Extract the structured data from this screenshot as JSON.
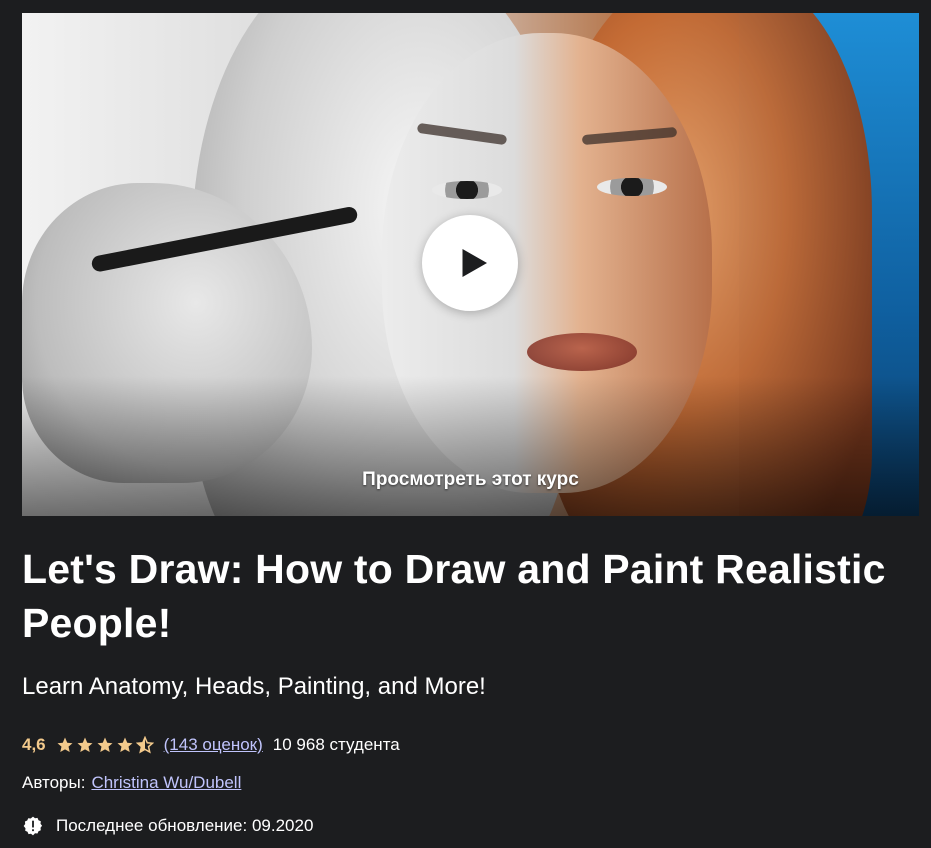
{
  "preview": {
    "caption": "Просмотреть этот курс",
    "play_icon": "play-icon"
  },
  "course": {
    "title": "Let's Draw: How to Draw and Paint Realistic People!",
    "subtitle": "Learn Anatomy, Heads, Painting, and More!",
    "rating": {
      "value": "4,6",
      "stars": 4.6,
      "reviews_text": "(143 оценок)",
      "students_text": "10 968 студента"
    },
    "authors_label": "Авторы:",
    "author_name": "Christina Wu/Dubell",
    "last_updated": "Последнее обновление: 09.2020",
    "update_icon": "alert-badge-icon"
  },
  "colors": {
    "background": "#1c1d1f",
    "rating": "#f3ca8c",
    "link": "#c0c4fc"
  }
}
